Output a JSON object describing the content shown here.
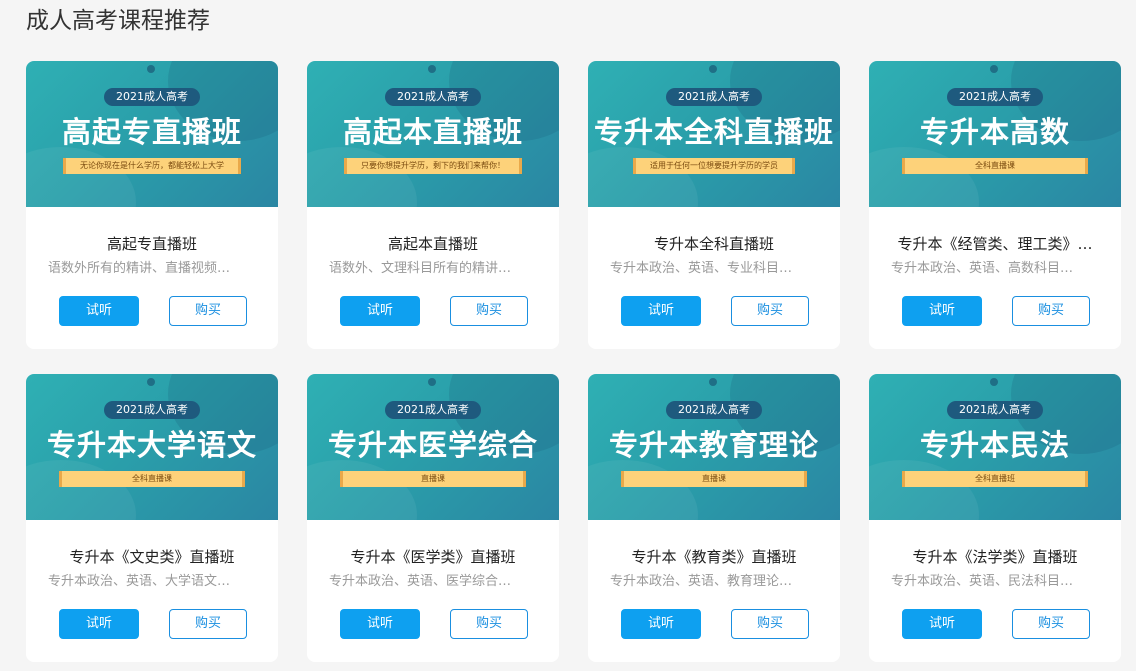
{
  "section": {
    "title": "成人高考课程推荐"
  },
  "buttons": {
    "listen": "试听",
    "buy": "购买"
  },
  "courses": [
    {
      "year": "2021成人高考",
      "banner": "高起专直播班",
      "ribbon": "无论你现在是什么学历，都能轻松上大学",
      "name": "高起专直播班",
      "desc": "语数外所有的精讲、直播视频…"
    },
    {
      "year": "2021成人高考",
      "banner": "高起本直播班",
      "ribbon": "只要你想提升学历，剩下的我们来帮你！",
      "name": "高起本直播班",
      "desc": "语数外、文理科目所有的精讲…"
    },
    {
      "year": "2021成人高考",
      "banner": "专升本全科直播班",
      "ribbon": "适用于任何一位想要提升学历的学员",
      "name": "专升本全科直播班",
      "desc": "专升本政治、英语、专业科目…"
    },
    {
      "year": "2021成人高考",
      "banner": "专升本高数",
      "ribbon": "全科直播课",
      "name": "专升本《经管类、理工类》…",
      "desc": "专升本政治、英语、高数科目…"
    },
    {
      "year": "2021成人高考",
      "banner": "专升本大学语文",
      "ribbon": "全科直播课",
      "name": "专升本《文史类》直播班",
      "desc": "专升本政治、英语、大学语文…"
    },
    {
      "year": "2021成人高考",
      "banner": "专升本医学综合",
      "ribbon": "直播课",
      "name": "专升本《医学类》直播班",
      "desc": "专升本政治、英语、医学综合…"
    },
    {
      "year": "2021成人高考",
      "banner": "专升本教育理论",
      "ribbon": "直播课",
      "name": "专升本《教育类》直播班",
      "desc": "专升本政治、英语、教育理论…"
    },
    {
      "year": "2021成人高考",
      "banner": "专升本民法",
      "ribbon": "全科直播班",
      "name": "专升本《法学类》直播班",
      "desc": "专升本政治、英语、民法科目…"
    }
  ]
}
